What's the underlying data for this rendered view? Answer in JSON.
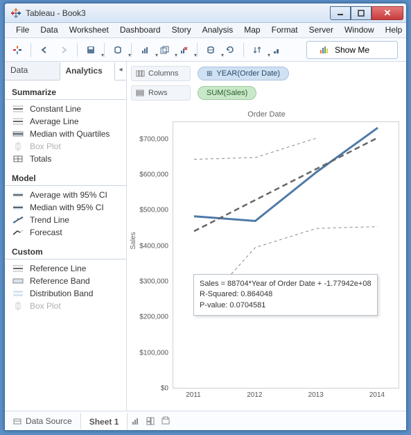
{
  "window": {
    "title": "Tableau - Book3"
  },
  "menu": [
    "File",
    "Data",
    "Worksheet",
    "Dashboard",
    "Story",
    "Analysis",
    "Map",
    "Format",
    "Server",
    "Window",
    "Help"
  ],
  "toolbar": {
    "show_me": "Show Me"
  },
  "sidepane": {
    "tabs": {
      "data": "Data",
      "analytics": "Analytics"
    },
    "summarize": {
      "header": "Summarize",
      "items": [
        {
          "label": "Constant Line",
          "enabled": true
        },
        {
          "label": "Average Line",
          "enabled": true
        },
        {
          "label": "Median with Quartiles",
          "enabled": true
        },
        {
          "label": "Box Plot",
          "enabled": false
        },
        {
          "label": "Totals",
          "enabled": true
        }
      ]
    },
    "model": {
      "header": "Model",
      "items": [
        {
          "label": "Average with 95% CI",
          "enabled": true
        },
        {
          "label": "Median with 95% CI",
          "enabled": true
        },
        {
          "label": "Trend Line",
          "enabled": true
        },
        {
          "label": "Forecast",
          "enabled": true
        }
      ]
    },
    "custom": {
      "header": "Custom",
      "items": [
        {
          "label": "Reference Line",
          "enabled": true
        },
        {
          "label": "Reference Band",
          "enabled": true
        },
        {
          "label": "Distribution Band",
          "enabled": true
        },
        {
          "label": "Box Plot",
          "enabled": false
        }
      ]
    }
  },
  "shelves": {
    "columns": {
      "label": "Columns",
      "pill": "YEAR(Order Date)"
    },
    "rows": {
      "label": "Rows",
      "pill": "SUM(Sales)"
    }
  },
  "chart": {
    "title": "Order Date",
    "ylabel": "Sales"
  },
  "tooltip": {
    "line1": "Sales = 88704*Year of Order Date + -1.77942e+08",
    "line2": "R-Squared: 0.864048",
    "line3": "P-value: 0.0704581"
  },
  "bottom": {
    "data_source": "Data Source",
    "sheet": "Sheet 1"
  },
  "chart_data": {
    "type": "line",
    "title": "Order Date",
    "xlabel": "",
    "ylabel": "Sales",
    "ylim": [
      0,
      750000
    ],
    "x": [
      2011,
      2012,
      2013,
      2014
    ],
    "series": [
      {
        "name": "SUM(Sales)",
        "values": [
          484000,
          471000,
          609000,
          734000
        ],
        "style": "solid",
        "color": "#4e79a7"
      },
      {
        "name": "Trend",
        "values": [
          442000,
          530000,
          618000,
          706000
        ],
        "style": "dashed-thick",
        "color": "#666"
      },
      {
        "name": "CI Lower",
        "values": [
          205000,
          396000,
          450000,
          455000
        ],
        "style": "dashed-thin",
        "color": "#888"
      },
      {
        "name": "CI Upper",
        "values": [
          645000,
          650000,
          705000,
          null
        ],
        "style": "dashed-thin",
        "color": "#888"
      }
    ],
    "yticks": [
      0,
      100000,
      200000,
      300000,
      400000,
      500000,
      600000,
      700000
    ],
    "ytick_labels": [
      "$0",
      "$100,000",
      "$200,000",
      "$300,000",
      "$400,000",
      "$500,000",
      "$600,000",
      "$700,000"
    ],
    "xticks": [
      2011,
      2012,
      2013,
      2014
    ],
    "xtick_labels": [
      "2011",
      "2012",
      "2013",
      "2014"
    ],
    "trend_equation": "Sales = 88704*Year of Order Date + -1.77942e+08",
    "r_squared": 0.864048,
    "p_value": 0.0704581
  }
}
